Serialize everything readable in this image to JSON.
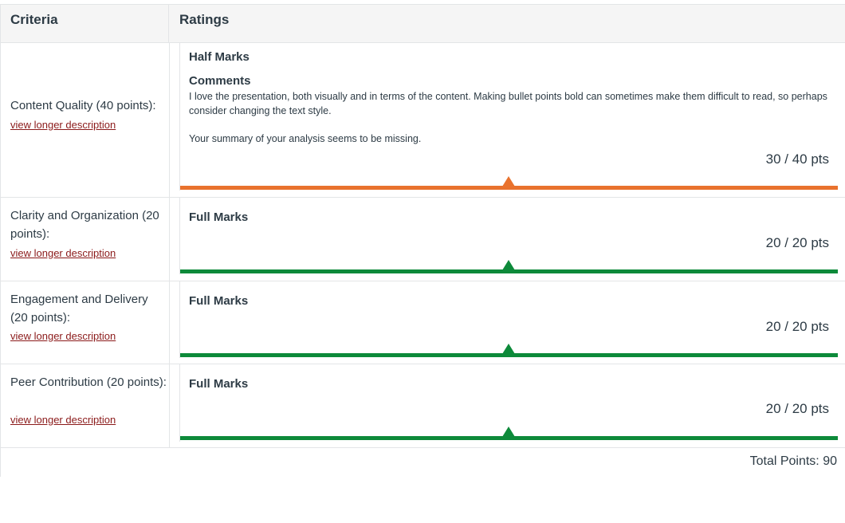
{
  "header": {
    "criteria_label": "Criteria",
    "ratings_label": "Ratings"
  },
  "colors": {
    "half": "#e9722d",
    "full": "#0d8a3a",
    "link": "#8b1a1a"
  },
  "criteria": [
    {
      "name": "Content Quality (40 points):",
      "link": "view longer description",
      "rating": "Half Marks",
      "comments_label": "Comments",
      "comments": [
        "I love the presentation, both visually and in terms of the content. Making bullet points bold can sometimes make them difficult to read, so perhaps consider changing the text style.",
        "Your summary of your analysis seems to be missing."
      ],
      "score": "30 / 40 pts",
      "score_fraction": 0.75,
      "status_color": "half"
    },
    {
      "name": "Clarity and Organization (20 points):",
      "link": "view longer description",
      "rating": "Full Marks",
      "score": "20 / 20 pts",
      "score_fraction": 1.0,
      "status_color": "full"
    },
    {
      "name": "Engagement and Delivery (20 points):",
      "link": "view longer description",
      "rating": "Full Marks",
      "score": "20 / 20 pts",
      "score_fraction": 1.0,
      "status_color": "full"
    },
    {
      "name": "Peer Contribution (20 points):",
      "link": "view longer description",
      "rating": "Full Marks",
      "score": "20 / 20 pts",
      "score_fraction": 1.0,
      "status_color": "full"
    }
  ],
  "total": "Total Points: 90"
}
